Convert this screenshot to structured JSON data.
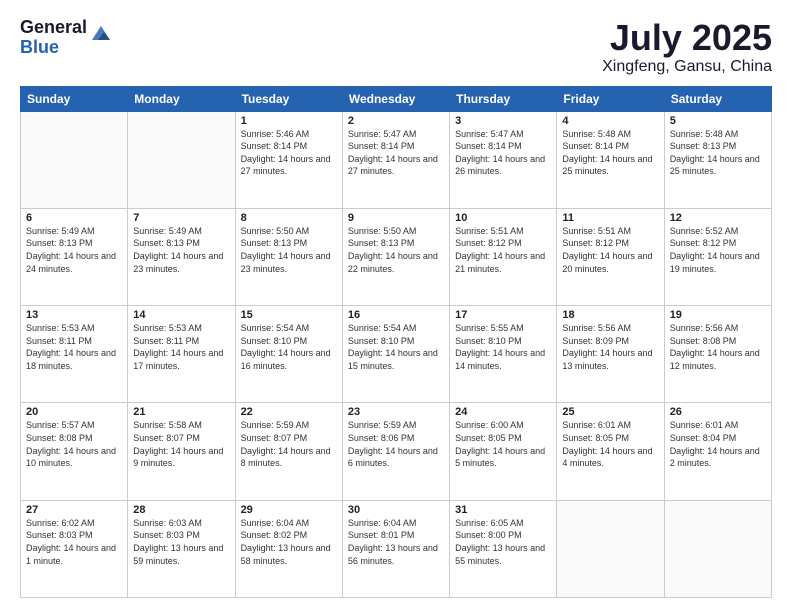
{
  "header": {
    "logo_general": "General",
    "logo_blue": "Blue",
    "month_title": "July 2025",
    "location": "Xingfeng, Gansu, China"
  },
  "weekdays": [
    "Sunday",
    "Monday",
    "Tuesday",
    "Wednesday",
    "Thursday",
    "Friday",
    "Saturday"
  ],
  "days": [
    {
      "num": "",
      "sunrise": "",
      "sunset": "",
      "daylight": ""
    },
    {
      "num": "",
      "sunrise": "",
      "sunset": "",
      "daylight": ""
    },
    {
      "num": "1",
      "sunrise": "Sunrise: 5:46 AM",
      "sunset": "Sunset: 8:14 PM",
      "daylight": "Daylight: 14 hours and 27 minutes."
    },
    {
      "num": "2",
      "sunrise": "Sunrise: 5:47 AM",
      "sunset": "Sunset: 8:14 PM",
      "daylight": "Daylight: 14 hours and 27 minutes."
    },
    {
      "num": "3",
      "sunrise": "Sunrise: 5:47 AM",
      "sunset": "Sunset: 8:14 PM",
      "daylight": "Daylight: 14 hours and 26 minutes."
    },
    {
      "num": "4",
      "sunrise": "Sunrise: 5:48 AM",
      "sunset": "Sunset: 8:14 PM",
      "daylight": "Daylight: 14 hours and 25 minutes."
    },
    {
      "num": "5",
      "sunrise": "Sunrise: 5:48 AM",
      "sunset": "Sunset: 8:13 PM",
      "daylight": "Daylight: 14 hours and 25 minutes."
    },
    {
      "num": "6",
      "sunrise": "Sunrise: 5:49 AM",
      "sunset": "Sunset: 8:13 PM",
      "daylight": "Daylight: 14 hours and 24 minutes."
    },
    {
      "num": "7",
      "sunrise": "Sunrise: 5:49 AM",
      "sunset": "Sunset: 8:13 PM",
      "daylight": "Daylight: 14 hours and 23 minutes."
    },
    {
      "num": "8",
      "sunrise": "Sunrise: 5:50 AM",
      "sunset": "Sunset: 8:13 PM",
      "daylight": "Daylight: 14 hours and 23 minutes."
    },
    {
      "num": "9",
      "sunrise": "Sunrise: 5:50 AM",
      "sunset": "Sunset: 8:13 PM",
      "daylight": "Daylight: 14 hours and 22 minutes."
    },
    {
      "num": "10",
      "sunrise": "Sunrise: 5:51 AM",
      "sunset": "Sunset: 8:12 PM",
      "daylight": "Daylight: 14 hours and 21 minutes."
    },
    {
      "num": "11",
      "sunrise": "Sunrise: 5:51 AM",
      "sunset": "Sunset: 8:12 PM",
      "daylight": "Daylight: 14 hours and 20 minutes."
    },
    {
      "num": "12",
      "sunrise": "Sunrise: 5:52 AM",
      "sunset": "Sunset: 8:12 PM",
      "daylight": "Daylight: 14 hours and 19 minutes."
    },
    {
      "num": "13",
      "sunrise": "Sunrise: 5:53 AM",
      "sunset": "Sunset: 8:11 PM",
      "daylight": "Daylight: 14 hours and 18 minutes."
    },
    {
      "num": "14",
      "sunrise": "Sunrise: 5:53 AM",
      "sunset": "Sunset: 8:11 PM",
      "daylight": "Daylight: 14 hours and 17 minutes."
    },
    {
      "num": "15",
      "sunrise": "Sunrise: 5:54 AM",
      "sunset": "Sunset: 8:10 PM",
      "daylight": "Daylight: 14 hours and 16 minutes."
    },
    {
      "num": "16",
      "sunrise": "Sunrise: 5:54 AM",
      "sunset": "Sunset: 8:10 PM",
      "daylight": "Daylight: 14 hours and 15 minutes."
    },
    {
      "num": "17",
      "sunrise": "Sunrise: 5:55 AM",
      "sunset": "Sunset: 8:10 PM",
      "daylight": "Daylight: 14 hours and 14 minutes."
    },
    {
      "num": "18",
      "sunrise": "Sunrise: 5:56 AM",
      "sunset": "Sunset: 8:09 PM",
      "daylight": "Daylight: 14 hours and 13 minutes."
    },
    {
      "num": "19",
      "sunrise": "Sunrise: 5:56 AM",
      "sunset": "Sunset: 8:08 PM",
      "daylight": "Daylight: 14 hours and 12 minutes."
    },
    {
      "num": "20",
      "sunrise": "Sunrise: 5:57 AM",
      "sunset": "Sunset: 8:08 PM",
      "daylight": "Daylight: 14 hours and 10 minutes."
    },
    {
      "num": "21",
      "sunrise": "Sunrise: 5:58 AM",
      "sunset": "Sunset: 8:07 PM",
      "daylight": "Daylight: 14 hours and 9 minutes."
    },
    {
      "num": "22",
      "sunrise": "Sunrise: 5:59 AM",
      "sunset": "Sunset: 8:07 PM",
      "daylight": "Daylight: 14 hours and 8 minutes."
    },
    {
      "num": "23",
      "sunrise": "Sunrise: 5:59 AM",
      "sunset": "Sunset: 8:06 PM",
      "daylight": "Daylight: 14 hours and 6 minutes."
    },
    {
      "num": "24",
      "sunrise": "Sunrise: 6:00 AM",
      "sunset": "Sunset: 8:05 PM",
      "daylight": "Daylight: 14 hours and 5 minutes."
    },
    {
      "num": "25",
      "sunrise": "Sunrise: 6:01 AM",
      "sunset": "Sunset: 8:05 PM",
      "daylight": "Daylight: 14 hours and 4 minutes."
    },
    {
      "num": "26",
      "sunrise": "Sunrise: 6:01 AM",
      "sunset": "Sunset: 8:04 PM",
      "daylight": "Daylight: 14 hours and 2 minutes."
    },
    {
      "num": "27",
      "sunrise": "Sunrise: 6:02 AM",
      "sunset": "Sunset: 8:03 PM",
      "daylight": "Daylight: 14 hours and 1 minute."
    },
    {
      "num": "28",
      "sunrise": "Sunrise: 6:03 AM",
      "sunset": "Sunset: 8:03 PM",
      "daylight": "Daylight: 13 hours and 59 minutes."
    },
    {
      "num": "29",
      "sunrise": "Sunrise: 6:04 AM",
      "sunset": "Sunset: 8:02 PM",
      "daylight": "Daylight: 13 hours and 58 minutes."
    },
    {
      "num": "30",
      "sunrise": "Sunrise: 6:04 AM",
      "sunset": "Sunset: 8:01 PM",
      "daylight": "Daylight: 13 hours and 56 minutes."
    },
    {
      "num": "31",
      "sunrise": "Sunrise: 6:05 AM",
      "sunset": "Sunset: 8:00 PM",
      "daylight": "Daylight: 13 hours and 55 minutes."
    },
    {
      "num": "",
      "sunrise": "",
      "sunset": "",
      "daylight": ""
    },
    {
      "num": "",
      "sunrise": "",
      "sunset": "",
      "daylight": ""
    }
  ]
}
